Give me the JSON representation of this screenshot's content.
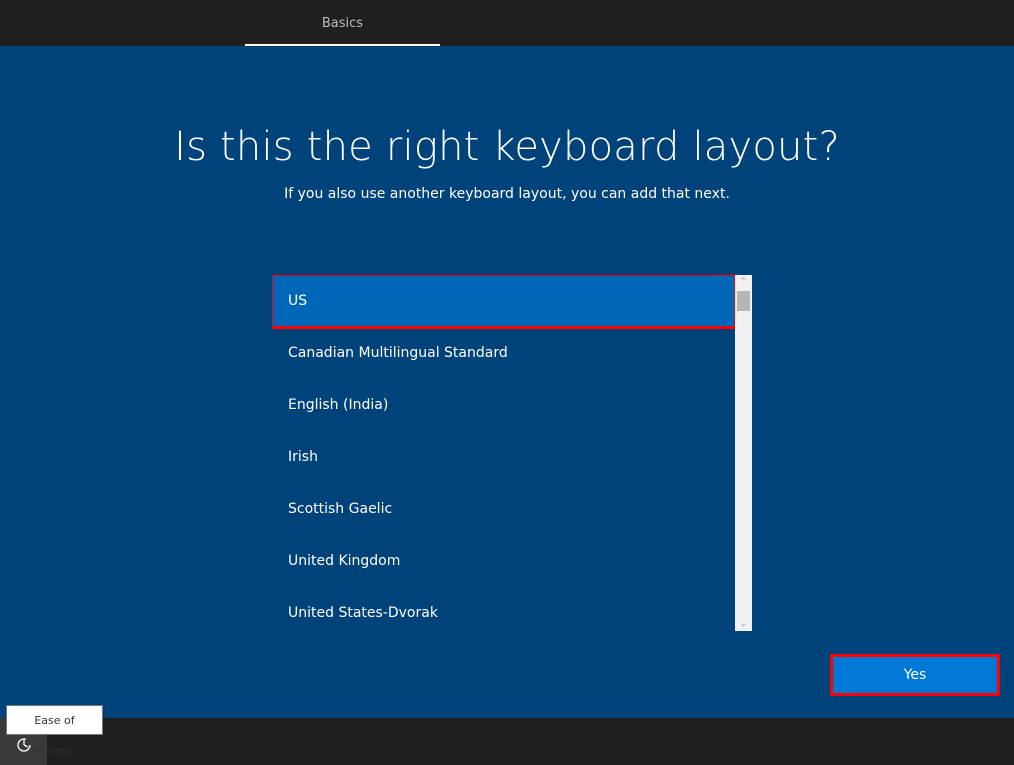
{
  "header": {
    "tabs": [
      {
        "label": "Basics",
        "active": true
      }
    ]
  },
  "main": {
    "title": "Is this the right keyboard layout?",
    "subtitle": "If you also use another keyboard layout, you can add that next.",
    "layouts": [
      {
        "label": "US",
        "selected": true
      },
      {
        "label": "Canadian Multilingual Standard",
        "selected": false
      },
      {
        "label": "English (India)",
        "selected": false
      },
      {
        "label": "Irish",
        "selected": false
      },
      {
        "label": "Scottish Gaelic",
        "selected": false
      },
      {
        "label": "United Kingdom",
        "selected": false
      },
      {
        "label": "United States-Dvorak",
        "selected": false
      }
    ],
    "yes_label": "Yes"
  },
  "footer": {
    "ease_of_access_tooltip": "Ease of access",
    "ease_icon": "ease-of-access-icon"
  },
  "colors": {
    "background": "#00427a",
    "bar": "#1f1f1f",
    "selected": "#0067b8",
    "button": "#0078d7",
    "highlight": "#ff0000"
  }
}
